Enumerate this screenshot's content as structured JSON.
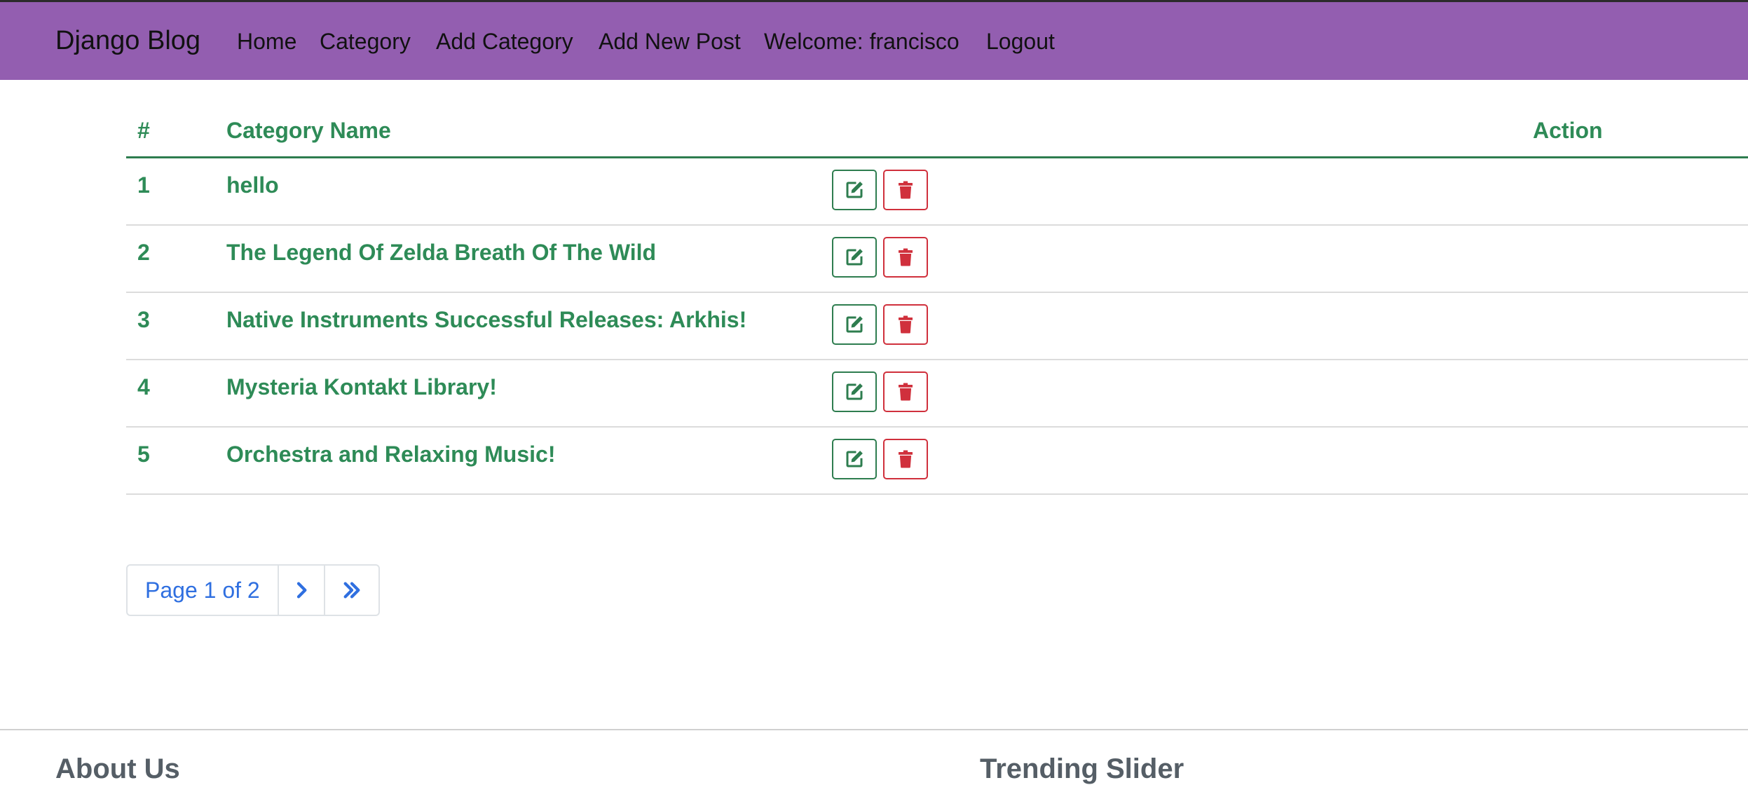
{
  "navbar": {
    "brand": "Django Blog",
    "links": [
      "Home",
      "Category",
      "Add Category",
      "Add New Post",
      "Welcome: francisco",
      "Logout"
    ],
    "background_color": "#935eb0"
  },
  "table": {
    "headers": {
      "number": "#",
      "name": "Category Name",
      "action": "Action"
    },
    "rows": [
      {
        "id": "1",
        "name": "hello"
      },
      {
        "id": "2",
        "name": "The Legend Of Zelda Breath Of The Wild"
      },
      {
        "id": "3",
        "name": "Native Instruments Successful Releases: Arkhis!"
      },
      {
        "id": "4",
        "name": "Mysteria Kontakt Library!"
      },
      {
        "id": "5",
        "name": "Orchestra and Relaxing Music!"
      }
    ],
    "text_color": "#2e8b57",
    "edit_icon": "edit-icon",
    "delete_icon": "trash-icon",
    "delete_color": "#d0303c"
  },
  "pagination": {
    "info": "Page 1 of 2",
    "next_icon": "chevron-right-icon",
    "last_icon": "double-chevron-right-icon",
    "color": "#2f6fe0"
  },
  "footer": {
    "about_heading": "About Us",
    "trending_heading": "Trending Slider"
  }
}
